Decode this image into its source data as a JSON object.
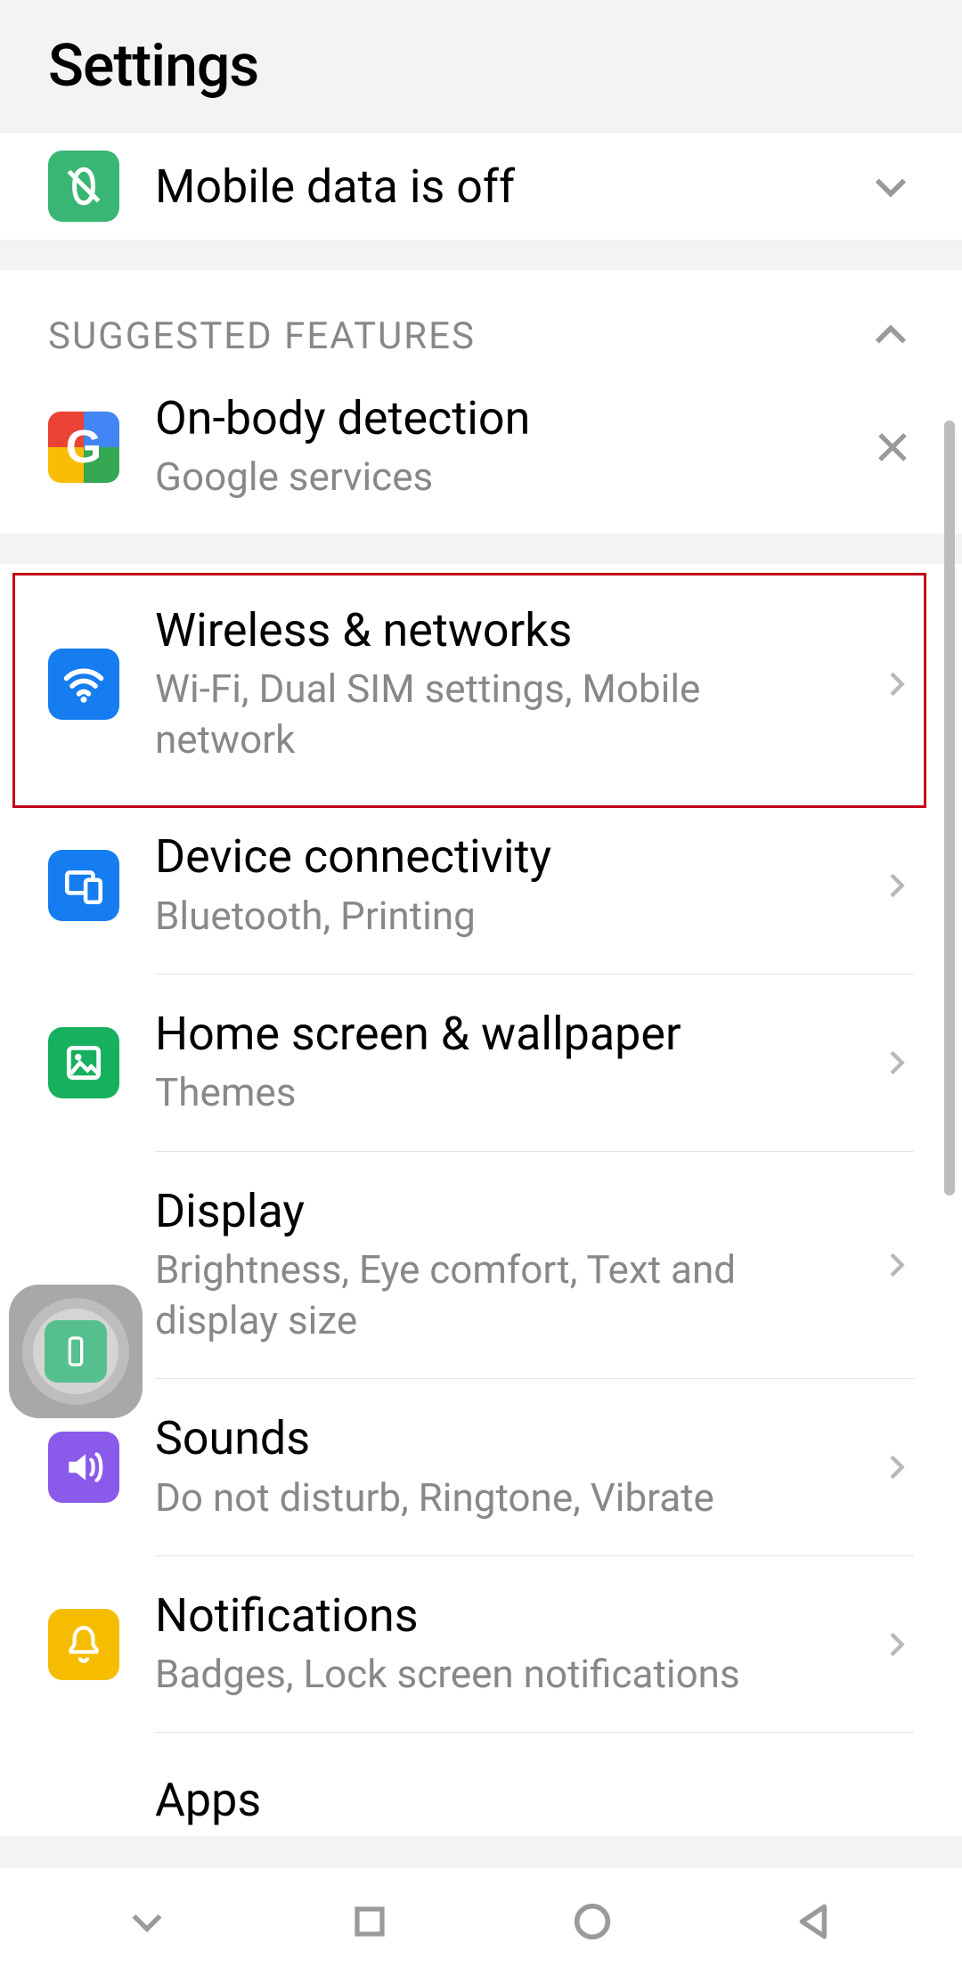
{
  "header": {
    "title": "Settings"
  },
  "status": {
    "text": "Mobile data is off"
  },
  "suggested": {
    "heading": "SUGGESTED FEATURES",
    "item": {
      "title": "On-body detection",
      "subtitle": "Google services"
    }
  },
  "list": {
    "wireless": {
      "title": "Wireless & networks",
      "subtitle": "Wi-Fi, Dual SIM settings, Mobile network"
    },
    "device": {
      "title": "Device connectivity",
      "subtitle": "Bluetooth, Printing"
    },
    "home": {
      "title": "Home screen & wallpaper",
      "subtitle": "Themes"
    },
    "display": {
      "title": "Display",
      "subtitle": "Brightness, Eye comfort, Text and display size"
    },
    "sounds": {
      "title": "Sounds",
      "subtitle": "Do not disturb, Ringtone, Vibrate"
    },
    "notifications": {
      "title": "Notifications",
      "subtitle": "Badges, Lock screen notifications"
    },
    "apps": {
      "title": "Apps"
    }
  },
  "colors": {
    "green": "#39b673",
    "blue": "#157df0",
    "purple": "#8a5bea",
    "yellow": "#f6bd00"
  }
}
